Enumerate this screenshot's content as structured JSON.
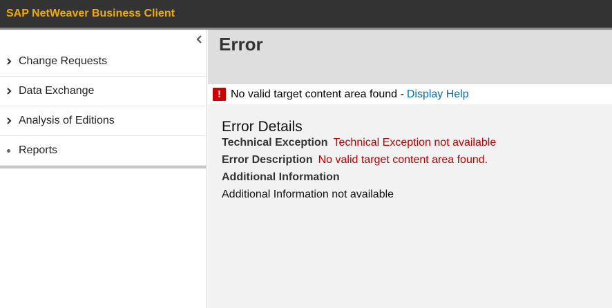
{
  "app": {
    "title": "SAP NetWeaver Business Client"
  },
  "sidebar": {
    "collapse_icon": "chevron-left-icon",
    "items": [
      {
        "label": "Change Requests",
        "icon": "chevron-right-icon"
      },
      {
        "label": "Data Exchange",
        "icon": "chevron-right-icon"
      },
      {
        "label": "Analysis of Editions",
        "icon": "chevron-right-icon"
      },
      {
        "label": "Reports",
        "icon": "bullet-icon"
      }
    ]
  },
  "main": {
    "page_title": "Error",
    "message": {
      "icon": "error-icon",
      "icon_glyph": "!",
      "text": "No valid target content area found -",
      "link": "Display Help"
    },
    "details": {
      "title": "Error Details",
      "technical_exception_label": "Technical Exception",
      "technical_exception_value": "Technical Exception not available",
      "error_description_label": "Error Description",
      "error_description_value": "No valid target content area found.",
      "additional_info_label": "Additional Information",
      "additional_info_value": "Additional Information not available"
    }
  },
  "colors": {
    "title_text": "#f0ab00",
    "title_bar": "#333333",
    "error_red": "#bb0000",
    "link_blue": "#0a6ea8"
  }
}
